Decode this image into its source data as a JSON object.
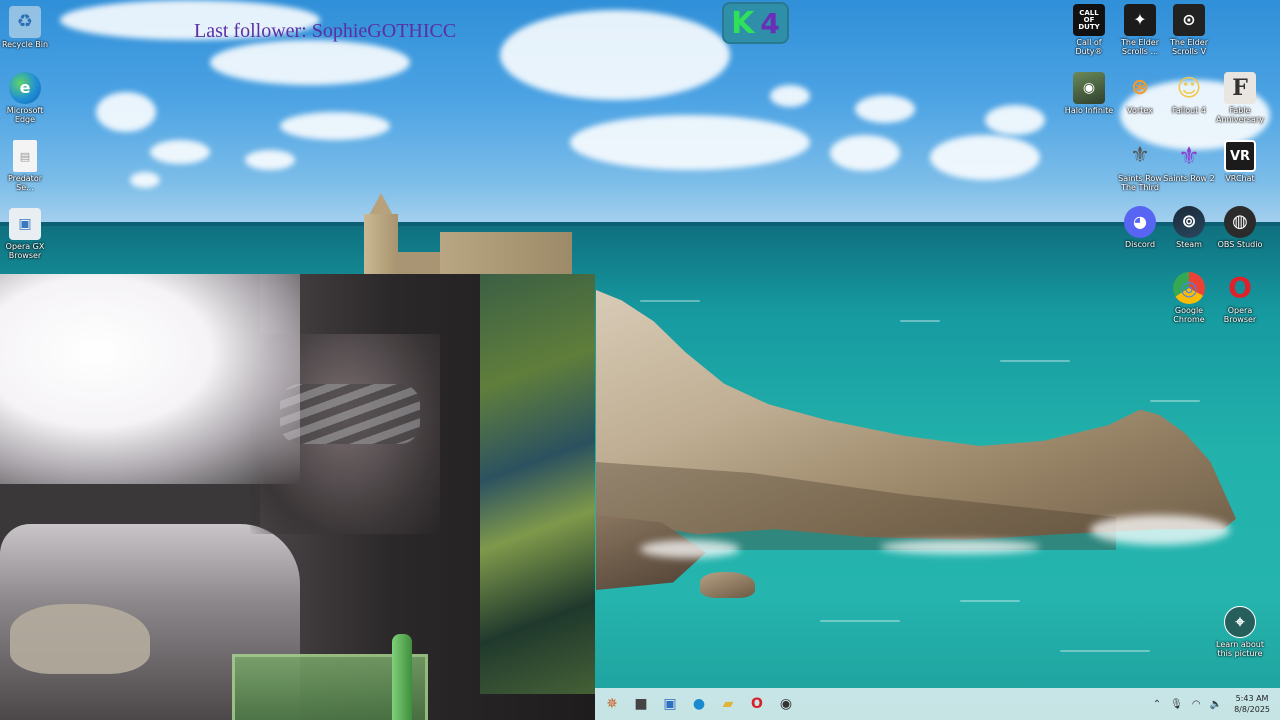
{
  "overlay": {
    "last_follower": "Last follower: SophieGOTHICC",
    "badge_letter": "K",
    "badge_number": "4"
  },
  "desktop_icons_left": [
    {
      "label": "Recycle Bin",
      "icon": "recycle-bin-icon"
    },
    {
      "label": "Microsoft Edge",
      "icon": "edge-icon"
    },
    {
      "label": "Predator Se...",
      "icon": "file-icon"
    },
    {
      "label": "Opera GX Browser",
      "icon": "opera-gx-icon"
    }
  ],
  "desktop_icons_right": [
    {
      "label": "Call of Duty®",
      "glyph": "CALL OF DUTY"
    },
    {
      "label": "The Elder Scrolls ...",
      "glyph": "✦"
    },
    {
      "label": "The Elder Scrolls V",
      "glyph": "⊙"
    },
    {
      "label": "Halo Infinite",
      "glyph": "◉"
    },
    {
      "label": "Vortex",
      "glyph": "⊛"
    },
    {
      "label": "Fallout 4",
      "glyph": "☺"
    },
    {
      "label": "Fable Anniversary",
      "glyph": "F"
    },
    {
      "label": "Saints Row The Third",
      "glyph": "⚜"
    },
    {
      "label": "Saints Row 2",
      "glyph": "⚜"
    },
    {
      "label": "VRChat",
      "glyph": "VR"
    },
    {
      "label": "Discord",
      "glyph": "◕"
    },
    {
      "label": "Steam",
      "glyph": "⊚"
    },
    {
      "label": "OBS Studio",
      "glyph": "◍"
    },
    {
      "label": "Google Chrome",
      "glyph": "◎"
    },
    {
      "label": "Opera Browser",
      "glyph": "O"
    },
    {
      "label": "Learn about this picture",
      "glyph": "⌖"
    }
  ],
  "taskbar": {
    "apps": [
      "start-app-icon",
      "task-view-icon",
      "widgets-icon",
      "edge-icon",
      "file-explorer-icon",
      "opera-icon",
      "obs-icon"
    ],
    "time": "5:43 AM",
    "date": "8/8/2025"
  },
  "colors": {
    "follower_text": "#5b2fa4",
    "badge_bg": "#2f8ea8",
    "badge_k": "#2fe05a",
    "badge_4": "#6a2fb8",
    "taskbar_bg": "#d6e9ec"
  }
}
